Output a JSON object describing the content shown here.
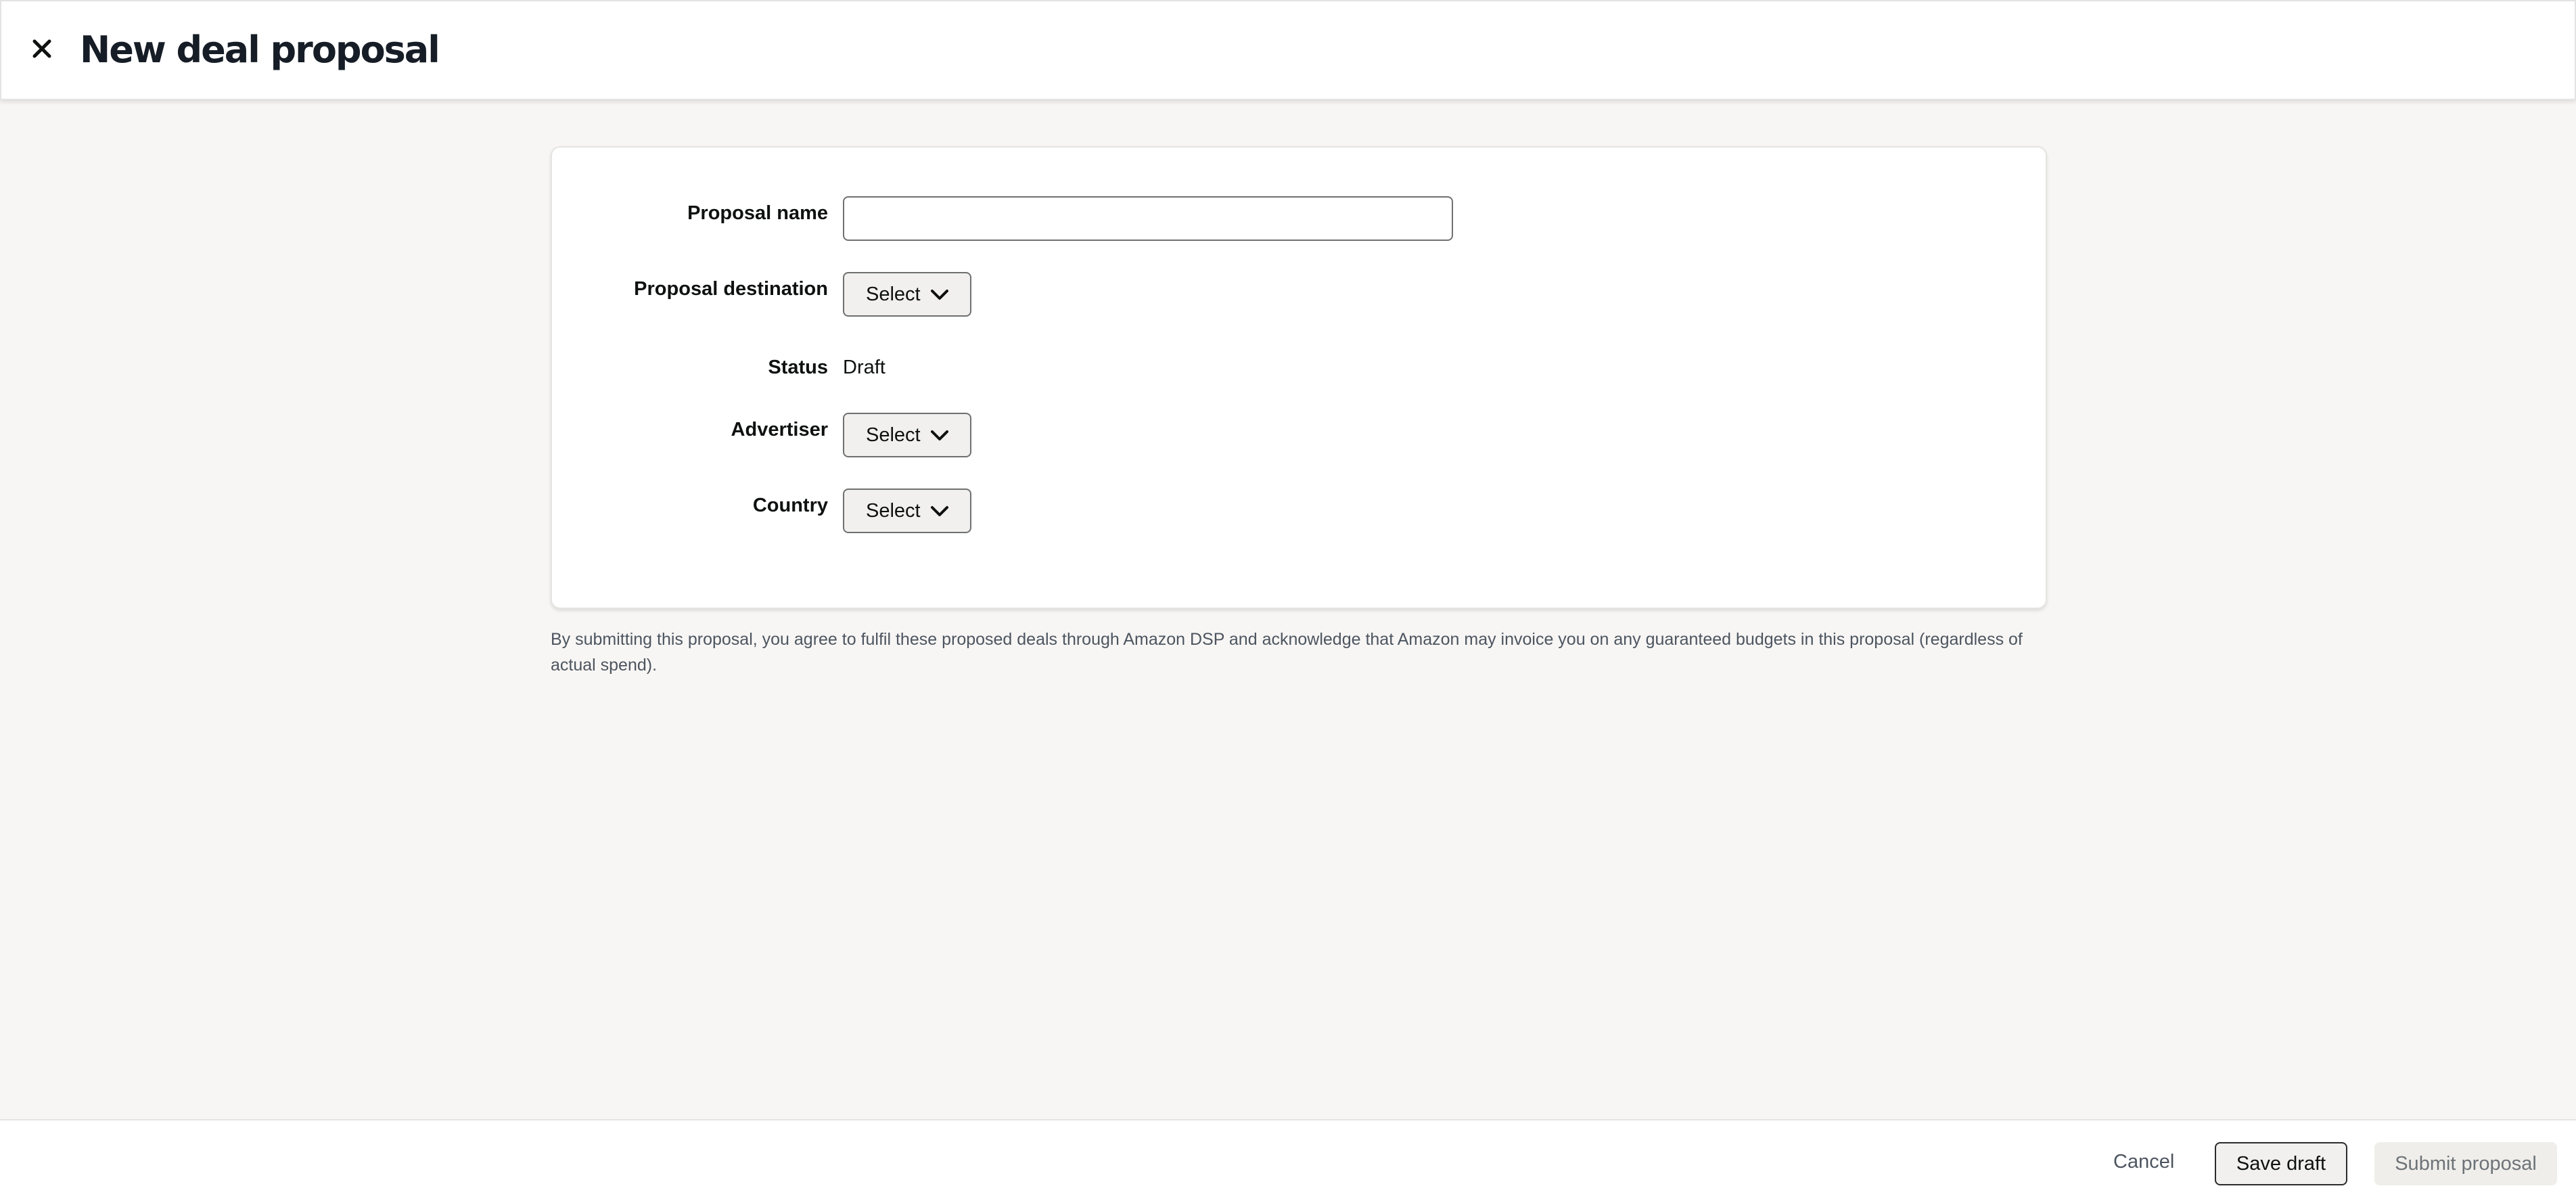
{
  "header": {
    "title": "New deal proposal",
    "close_icon": "close-icon"
  },
  "form": {
    "proposal_name": {
      "label": "Proposal name",
      "value": "",
      "placeholder": ""
    },
    "proposal_destination": {
      "label": "Proposal destination",
      "selected": "Select",
      "icon": "chevron-down-icon"
    },
    "status": {
      "label": "Status",
      "value": "Draft"
    },
    "advertiser": {
      "label": "Advertiser",
      "selected": "Select",
      "icon": "chevron-down-icon"
    },
    "country": {
      "label": "Country",
      "selected": "Select",
      "icon": "chevron-down-icon"
    }
  },
  "disclaimer": "By submitting this proposal, you agree to fulfil these proposed deals through Amazon DSP and acknowledge that Amazon may invoice you on any guaranteed budgets in this proposal (regardless of actual spend).",
  "footer": {
    "cancel_label": "Cancel",
    "save_label": "Save draft",
    "submit_label": "Submit proposal"
  },
  "colors": {
    "page_background": "#f7f6f4",
    "title": "#161d26",
    "muted_text": "#4d5560",
    "disabled_text": "#6e7378"
  }
}
